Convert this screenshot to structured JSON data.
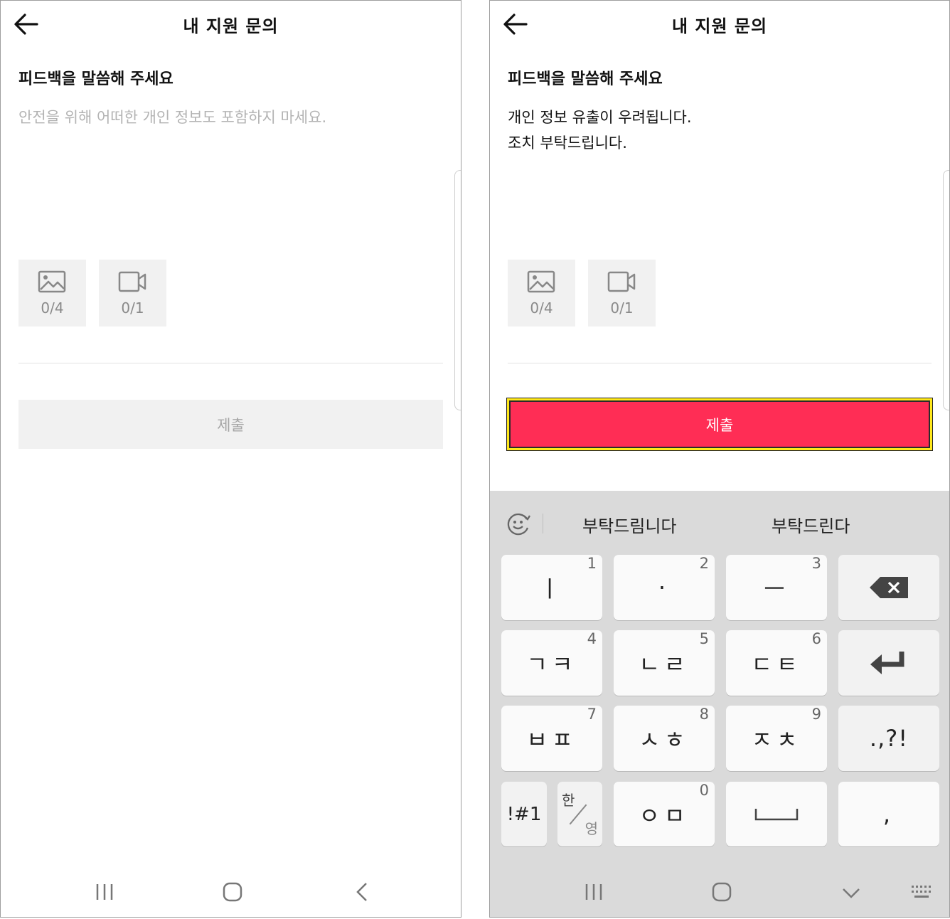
{
  "left": {
    "title": "내 지원 문의",
    "section_label": "피드백을 말씀해 주세요",
    "feedback_placeholder": "안전을 위해 어떠한 개인 정보도 포함하지 마세요.",
    "image_count": "0/4",
    "video_count": "0/1",
    "submit_label": "제출"
  },
  "right": {
    "title": "내 지원 문의",
    "section_label": "피드백을 말씀해 주세요",
    "feedback_line1": "개인 정보 유출이 우려됩니다.",
    "feedback_line2": "조치 부탁드립니다.",
    "image_count": "0/4",
    "video_count": "0/1",
    "submit_label": "제출",
    "submit_highlight_color": "#ffe81a",
    "submit_color": "#ff2d55",
    "keyboard": {
      "suggestions": [
        "부탁드림니다",
        "부탁드린다"
      ],
      "keys": [
        {
          "label": "ㅣ",
          "num": "1"
        },
        {
          "label": "·",
          "num": "2"
        },
        {
          "label": "ㅡ",
          "num": "3"
        },
        {
          "label": "ㄱㅋ",
          "num": "4"
        },
        {
          "label": "ㄴㄹ",
          "num": "5"
        },
        {
          "label": "ㄷㅌ",
          "num": "6"
        },
        {
          "label": "ㅂㅍ",
          "num": "7"
        },
        {
          "label": "ㅅㅎ",
          "num": "8"
        },
        {
          "label": "ㅈㅊ",
          "num": "9"
        },
        {
          "label": ".,?!",
          "num": ""
        },
        {
          "label": "!#1",
          "num": ""
        },
        {
          "label": "ㅇㅁ",
          "num": "0"
        },
        {
          "label": ",",
          "num": ""
        }
      ],
      "lang_a": "한",
      "lang_b": "영"
    }
  },
  "icons": [
    "back-arrow-icon",
    "image-icon",
    "video-icon",
    "recent-apps-icon",
    "home-icon",
    "back-nav-icon",
    "emoji-icon",
    "backspace-icon",
    "enter-icon",
    "space-icon",
    "keyboard-hide-icon",
    "keyboard-grid-icon"
  ]
}
